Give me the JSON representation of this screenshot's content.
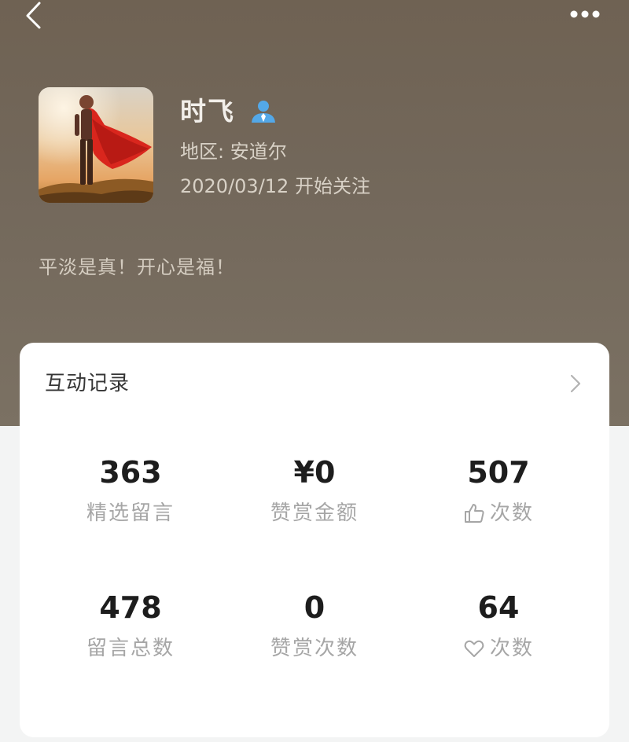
{
  "profile": {
    "name": "时飞",
    "region": "地区: 安道尔",
    "follow_date": "2020/03/12 开始关注",
    "bio": "平淡是真！开心是福！"
  },
  "icons": {
    "back": "back-chevron-icon",
    "more": "more-dots-icon",
    "verified": "person-badge-icon",
    "like": "thumbs-up-icon",
    "heart": "heart-icon",
    "chevron": "chevron-right-icon"
  },
  "colors": {
    "header": "#73685b",
    "verified": "#53a8e8",
    "card": "#ffffff",
    "value": "#1d1d1d",
    "label": "#a6a6a6"
  },
  "interaction": {
    "title": "互动记录",
    "stats": [
      {
        "value": "363",
        "label": "精选留言"
      },
      {
        "value": "¥0",
        "label": "赞赏金额"
      },
      {
        "value": "507",
        "label": "次数"
      },
      {
        "value": "478",
        "label": "留言总数"
      },
      {
        "value": "0",
        "label": "赞赏次数"
      },
      {
        "value": "64",
        "label": "次数"
      }
    ]
  }
}
